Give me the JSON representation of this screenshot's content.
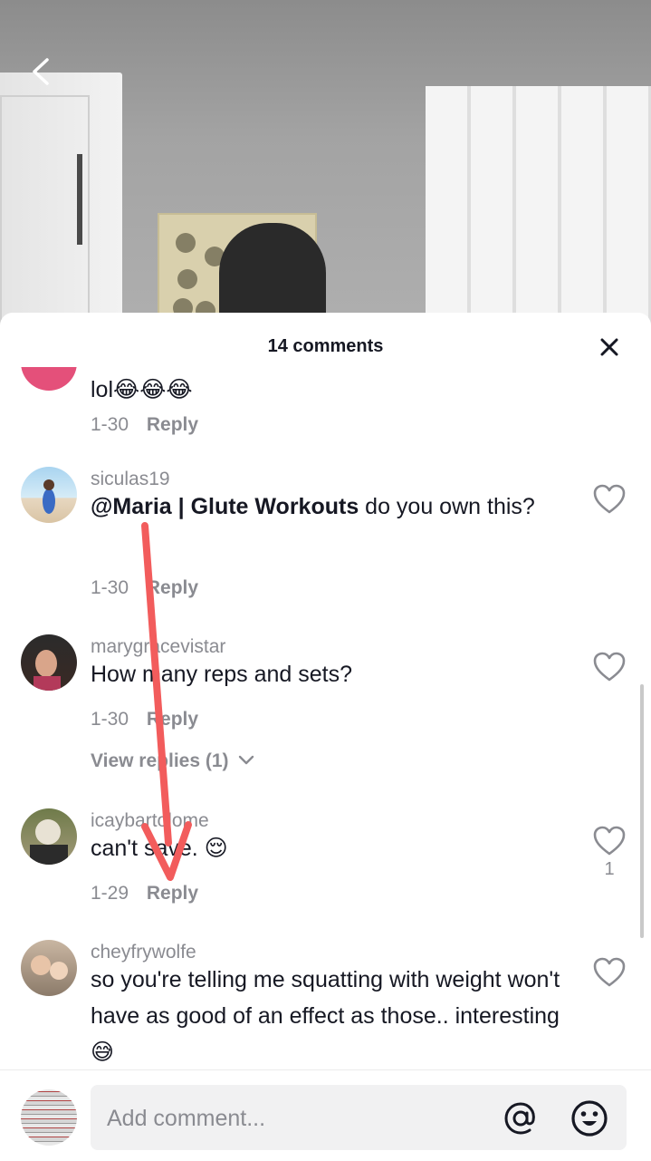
{
  "header": {
    "title": "14 comments"
  },
  "comments": [
    {
      "username": "",
      "text": "lol😂😂😂",
      "date": "1-30",
      "reply_label": "Reply"
    },
    {
      "username": "siculas19",
      "mention": "@Maria | Glute Workouts",
      "text": " do you own this?",
      "date": "1-30",
      "reply_label": "Reply"
    },
    {
      "username": "marygracevistar",
      "text": "How many reps and sets?",
      "date": "1-30",
      "reply_label": "Reply",
      "view_replies": "View replies (1)"
    },
    {
      "username": "icaybartolome",
      "text": "can't save. 😌",
      "date": "1-29",
      "reply_label": "Reply",
      "likes": "1"
    },
    {
      "username": "cheyfrywolfe",
      "text": "so you're telling me squatting with weight won't have as good of an effect as those.. interesting 😅"
    }
  ],
  "input": {
    "placeholder": "Add comment..."
  },
  "icons": {
    "back": "back-chevron-icon",
    "close": "close-icon",
    "like": "heart-outline-icon",
    "mention": "at-sign-icon",
    "emoji": "emoji-icon",
    "view_replies": "chevron-down-icon"
  },
  "colors": {
    "annotation_arrow": "#f25c5c",
    "text_primary": "#161823",
    "text_secondary": "#8a8b91"
  }
}
